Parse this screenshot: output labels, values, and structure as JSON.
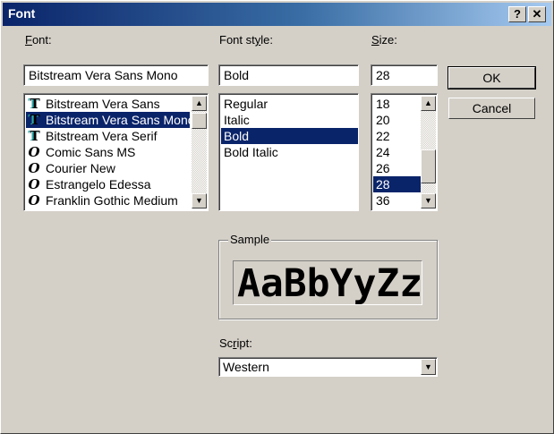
{
  "window": {
    "title": "Font",
    "help_label": "?",
    "close_label": "✕"
  },
  "font": {
    "label_hotkey": "F",
    "label_rest": "ont:",
    "value": "Bitstream Vera Sans Mono",
    "items": [
      {
        "name": "Bitstream Vera Sans",
        "icon": "truetype-icon"
      },
      {
        "name": "Bitstream Vera Sans Mono",
        "icon": "truetype-icon",
        "selected": true
      },
      {
        "name": "Bitstream Vera Serif",
        "icon": "truetype-icon"
      },
      {
        "name": "Comic Sans MS",
        "icon": "opentype-icon"
      },
      {
        "name": "Courier New",
        "icon": "opentype-icon"
      },
      {
        "name": "Estrangelo Edessa",
        "icon": "opentype-icon"
      },
      {
        "name": "Franklin Gothic Medium",
        "icon": "opentype-icon"
      }
    ]
  },
  "style": {
    "label_pre": "Font st",
    "label_hotkey": "y",
    "label_rest": "le:",
    "value": "Bold",
    "items": [
      "Regular",
      "Italic",
      "Bold",
      "Bold Italic"
    ],
    "selected": 2
  },
  "size": {
    "label_hotkey": "S",
    "label_rest": "ize:",
    "value": "28",
    "items": [
      "18",
      "20",
      "22",
      "24",
      "26",
      "28",
      "36"
    ],
    "selected": 5
  },
  "buttons": {
    "ok": "OK",
    "cancel": "Cancel"
  },
  "sample": {
    "label": "Sample",
    "text": "AaBbYyZz"
  },
  "script": {
    "label_pre": "Sc",
    "label_hotkey": "r",
    "label_rest": "ipt:",
    "value": "Western"
  },
  "icons": {
    "scroll_up": "▲",
    "scroll_down": "▼",
    "truetype_glyph_a": "T",
    "truetype_glyph_b": "T",
    "opentype_glyph": "O"
  }
}
